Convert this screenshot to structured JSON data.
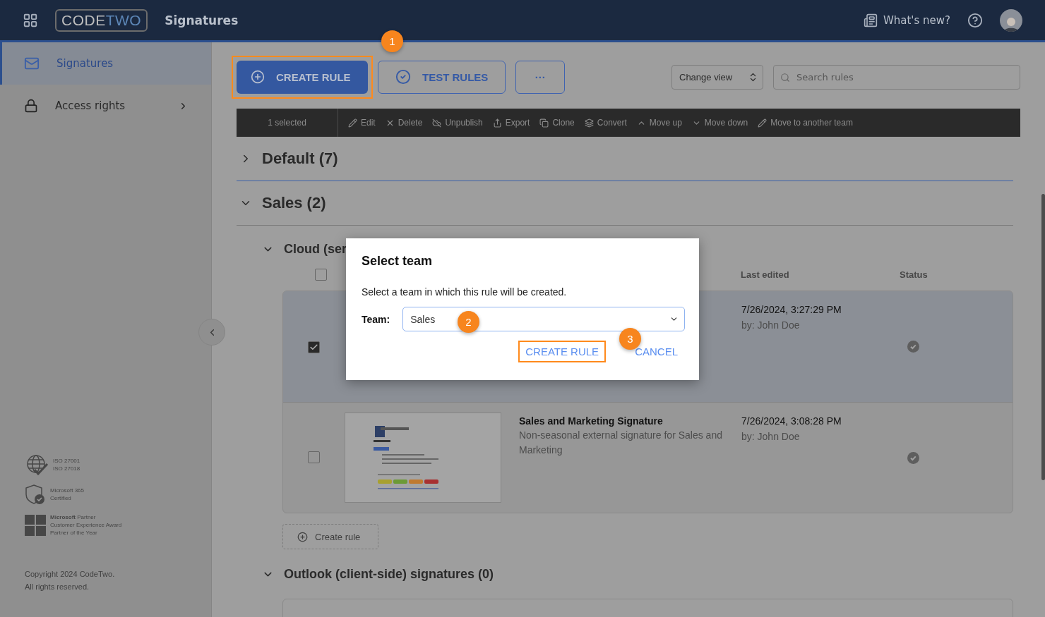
{
  "header": {
    "logo": {
      "part_1": "CODE",
      "part_2": "TWO"
    },
    "app_title": "Signatures",
    "whats_new": "What's new?"
  },
  "sidebar": {
    "items": [
      {
        "label": "Signatures",
        "selected": true,
        "has_submenu": false,
        "kind": "signatures"
      },
      {
        "label": "Access rights",
        "selected": false,
        "has_submenu": true,
        "kind": "access"
      }
    ],
    "certificates": [
      {
        "kind": "iso",
        "lines": [
          "ISO 27001",
          "ISO 27018"
        ]
      },
      {
        "kind": "shield",
        "lines": [
          "Microsoft 365",
          "Certified"
        ]
      },
      {
        "kind": "windows",
        "lines": [
          "**Microsoft** Partner",
          "Customer Experience Award",
          "Partner of the Year"
        ]
      }
    ],
    "copyright": [
      "Copyright 2024 CodeTwo.",
      "All rights reserved."
    ]
  },
  "toolbar": {
    "buttons": [
      {
        "kind": "primary",
        "label": "CREATE RULE",
        "highlighted": true
      },
      {
        "kind": "outline",
        "label": "TEST RULES",
        "highlighted": false
      },
      {
        "kind": "more",
        "label": "···",
        "highlighted": false
      }
    ],
    "change_view": "Change view",
    "search": {
      "placeholder": "Search rules"
    }
  },
  "action_bar": {
    "selected_count": "1 selected",
    "actions": [
      {
        "kind": "edit",
        "label": "Edit"
      },
      {
        "kind": "delete",
        "label": "Delete"
      },
      {
        "kind": "unpublish",
        "label": "Unpublish"
      },
      {
        "kind": "export",
        "label": "Export"
      },
      {
        "kind": "clone",
        "label": "Clone"
      },
      {
        "kind": "convert",
        "label": "Convert"
      },
      {
        "kind": "up",
        "label": "Move up"
      },
      {
        "kind": "down",
        "label": "Move down"
      },
      {
        "kind": "move",
        "label": "Move to another team"
      }
    ]
  },
  "teams": [
    {
      "title": "Default (7)",
      "expanded": false
    },
    {
      "title": "Sales (2)",
      "expanded": true
    }
  ],
  "sections": [
    {
      "title": "Cloud (ser",
      "expanded": true,
      "columns": {
        "select_all_checked": false,
        "last_edited": "Last edited",
        "status": "Status"
      },
      "rows": [
        {
          "selected": true,
          "checked": true,
          "edited": "7/26/2024, 3:27:29 PM",
          "by": "by: John Doe",
          "published": true
        },
        {
          "selected": false,
          "checked": false,
          "name": "Sales and Marketing Signature",
          "description": "Non-seasonal external signature for Sales and Marketing",
          "edited": "7/26/2024, 3:08:28 PM",
          "by": "by: John Doe",
          "published": true
        }
      ],
      "add_button": "Create rule"
    },
    {
      "title": "Outlook (client-side) signatures (0)",
      "expanded": true
    }
  ],
  "dialog": {
    "title": "Select team",
    "message": "Select a team in which this rule will be created.",
    "team_label": "Team:",
    "team_value": "Sales",
    "buttons": [
      {
        "label": "CREATE RULE",
        "highlighted": true
      },
      {
        "label": "CANCEL",
        "highlighted": false
      }
    ]
  },
  "callouts": [
    "1",
    "2",
    "3"
  ]
}
